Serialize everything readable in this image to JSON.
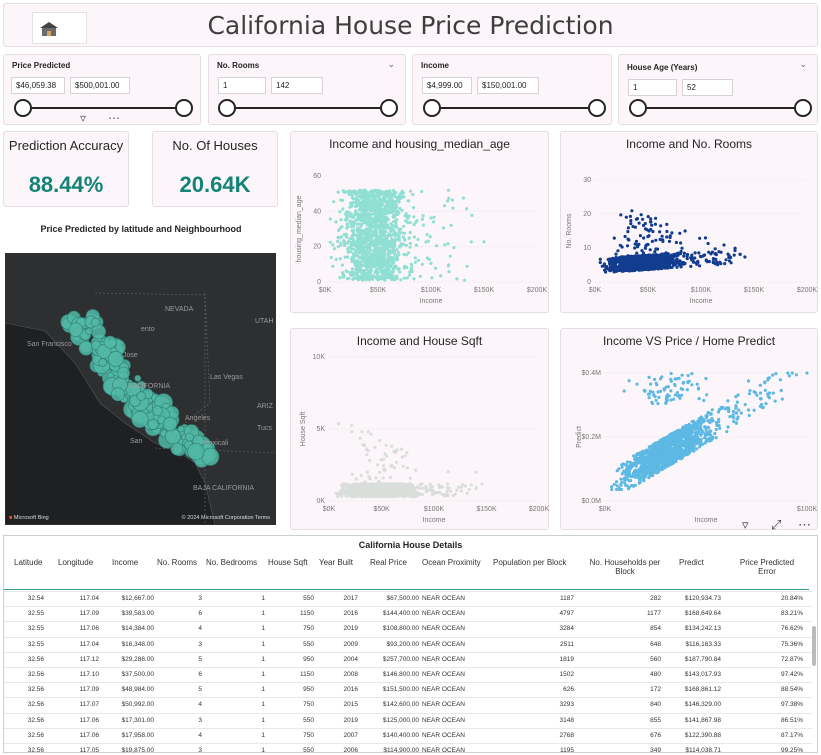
{
  "header": {
    "title": "California House Price Prediction"
  },
  "slicers": [
    {
      "title": "Price Predicted",
      "min": "$46,059.38",
      "max": "$500,001.00",
      "dropdown": false
    },
    {
      "title": "No. Rooms",
      "min": "1",
      "max": "142",
      "dropdown": true
    },
    {
      "title": "Income",
      "min": "$4,999.00",
      "max": "$150,001.00",
      "dropdown": false
    },
    {
      "title": "House Age (Years)",
      "min": "1",
      "max": "52",
      "dropdown": true
    }
  ],
  "kpis": [
    {
      "title": "Prediction Accuracy",
      "value": "88.44%"
    },
    {
      "title": "No. Of Houses",
      "value": "20.64K"
    }
  ],
  "map": {
    "title": "Price Predicted by latitude and Neighbourhood",
    "labels": [
      "NEVADA",
      "San Francisco",
      "UTAH",
      "Jose",
      "CALIFORNIA",
      "Las Vegas",
      "Angeles",
      "San",
      "Mexicali",
      "BAJA CALIFORNIA",
      "ARIZ",
      "Tucs",
      "ento"
    ],
    "attribution_left": "Microsoft Bing",
    "attribution_right": "© 2024 Microsoft Corporation  Terms",
    "point_color": "#52b9a6"
  },
  "charts": [
    {
      "title": "Income and housing_median_age",
      "chart_data": {
        "type": "scatter",
        "xlabel": "Income",
        "ylabel": "housing_median_age",
        "xticks": [
          "$0K",
          "$50K",
          "$100K",
          "$150K",
          "$200K"
        ],
        "yticks": [
          "0",
          "20",
          "40",
          "60"
        ],
        "xlim": [
          0,
          200000
        ],
        "ylim": [
          0,
          60
        ],
        "color": "#8fdfd2",
        "n_points": 20640
      }
    },
    {
      "title": "Income and No. Rooms",
      "chart_data": {
        "type": "scatter",
        "xlabel": "Income",
        "ylabel": "No. Rooms",
        "xticks": [
          "$0K",
          "$50K",
          "$100K",
          "$150K",
          "$200K"
        ],
        "yticks": [
          "0",
          "10",
          "20",
          "30"
        ],
        "xlim": [
          0,
          200000
        ],
        "ylim": [
          0,
          35
        ],
        "color": "#123d8f",
        "n_points": 20640
      }
    },
    {
      "title": "Income and House Sqft",
      "chart_data": {
        "type": "scatter",
        "xlabel": "Income",
        "ylabel": "House Sqft",
        "xticks": [
          "$0K",
          "$50K",
          "$100K",
          "$150K",
          "$200K"
        ],
        "yticks": [
          "0K",
          "5K",
          "10K"
        ],
        "xlim": [
          0,
          200000
        ],
        "ylim": [
          0,
          10000
        ],
        "color": "#d9dedb",
        "n_points": 20640
      }
    },
    {
      "title": "Income VS Price / Home Predict",
      "chart_data": {
        "type": "scatter",
        "xlabel": "Income",
        "ylabel": "Predict",
        "xticks": [
          "$0K",
          "$100K"
        ],
        "yticks": [
          "$0.0M",
          "$0.2M",
          "$0.4M"
        ],
        "xlim": [
          0,
          150000
        ],
        "ylim": [
          0,
          500000
        ],
        "color": "#5db9e3",
        "n_points": 20640
      }
    }
  ],
  "table": {
    "title": "California House Details",
    "columns": [
      "Latitude",
      "Longitude",
      "Income",
      "No. Rooms",
      "No. Bedrooms",
      "House Sqft",
      "Year Built",
      "Real Price",
      "Ocean Proximity",
      "Population per Block",
      "No. Households per Block",
      "Predict",
      "Price Predicted Error"
    ],
    "rows": [
      [
        "32.54",
        "117.04",
        "$12,667.00",
        "3",
        "1",
        "550",
        "2017",
        "$67,500.00",
        "NEAR OCEAN",
        "1187",
        "282",
        "$120,934.73",
        "20.84%"
      ],
      [
        "32.55",
        "117.09",
        "$39,583.00",
        "6",
        "1",
        "1150",
        "2016",
        "$144,400.00",
        "NEAR OCEAN",
        "4797",
        "1177",
        "$168,649.64",
        "83.21%"
      ],
      [
        "32.55",
        "117.06",
        "$14,384.00",
        "4",
        "1",
        "750",
        "2019",
        "$108,800.00",
        "NEAR OCEAN",
        "3284",
        "854",
        "$134,242.13",
        "76.62%"
      ],
      [
        "32.55",
        "117.04",
        "$16,348.00",
        "3",
        "1",
        "550",
        "2009",
        "$93,200.00",
        "NEAR OCEAN",
        "2511",
        "648",
        "$116,163.33",
        "75.36%"
      ],
      [
        "32.56",
        "117.12",
        "$29,286.00",
        "5",
        "1",
        "950",
        "2004",
        "$257,700.00",
        "NEAR OCEAN",
        "1819",
        "560",
        "$187,790.84",
        "72.87%"
      ],
      [
        "32.56",
        "117.10",
        "$37,500.00",
        "6",
        "1",
        "1150",
        "2008",
        "$146,800.00",
        "NEAR OCEAN",
        "1502",
        "480",
        "$143,017.93",
        "97.42%"
      ],
      [
        "32.56",
        "117.09",
        "$48,984.00",
        "5",
        "1",
        "950",
        "2016",
        "$151,500.00",
        "NEAR OCEAN",
        "626",
        "172",
        "$168,861.12",
        "88.54%"
      ],
      [
        "32.56",
        "117.07",
        "$50,992.00",
        "4",
        "1",
        "750",
        "2015",
        "$142,600.00",
        "NEAR OCEAN",
        "3293",
        "840",
        "$146,329.00",
        "97.38%"
      ],
      [
        "32.56",
        "117.06",
        "$17,301.00",
        "3",
        "1",
        "550",
        "2019",
        "$125,000.00",
        "NEAR OCEAN",
        "3148",
        "855",
        "$141,867.98",
        "86.51%"
      ],
      [
        "32.56",
        "117.06",
        "$17,958.00",
        "4",
        "1",
        "750",
        "2007",
        "$140,400.00",
        "NEAR OCEAN",
        "2768",
        "676",
        "$122,390.88",
        "87.17%"
      ],
      [
        "32.56",
        "117.05",
        "$19,875.00",
        "3",
        "1",
        "550",
        "2006",
        "$114,900.00",
        "NEAR OCEAN",
        "1195",
        "349",
        "$114,038.71",
        "99.25%"
      ]
    ]
  }
}
